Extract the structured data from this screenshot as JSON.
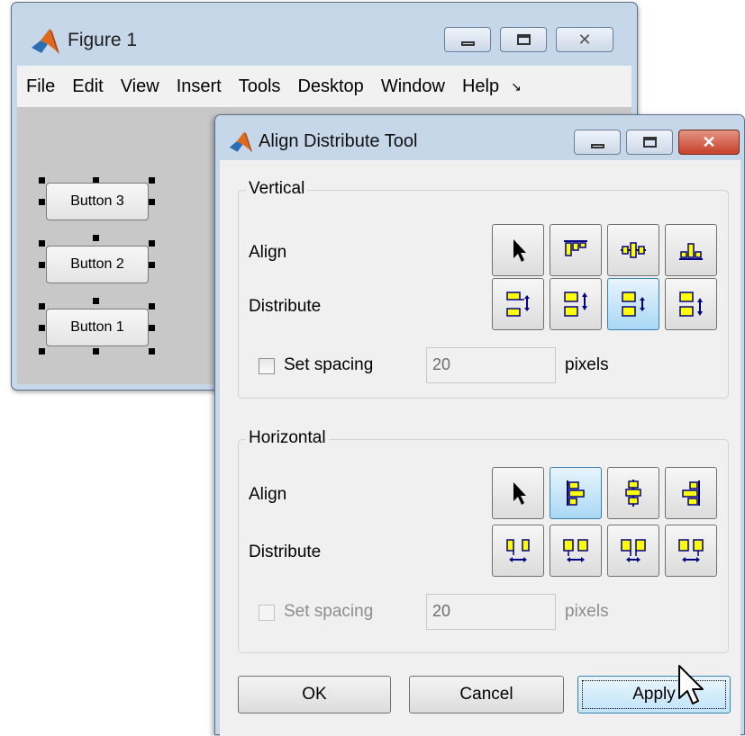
{
  "figure": {
    "title": "Figure 1",
    "menu": [
      "File",
      "Edit",
      "View",
      "Insert",
      "Tools",
      "Desktop",
      "Window",
      "Help"
    ],
    "menu_more": "↘",
    "buttons": [
      "Button 3",
      "Button 2",
      "Button 1"
    ]
  },
  "tool": {
    "title": "Align Distribute Tool",
    "vertical": {
      "title": "Vertical",
      "align_label": "Align",
      "distribute_label": "Distribute",
      "align_icons": [
        "pointer-icon",
        "align-top-icon",
        "align-middle-icon",
        "align-bottom-icon"
      ],
      "distribute_icons": [
        "distribute-top-icon",
        "distribute-middle-icon",
        "distribute-gap-icon",
        "distribute-bottom-icon"
      ],
      "selected_distribute": 2,
      "spacing_label": "Set spacing",
      "spacing_value": "20",
      "spacing_unit": "pixels",
      "spacing_checked": false
    },
    "horizontal": {
      "title": "Horizontal",
      "align_label": "Align",
      "distribute_label": "Distribute",
      "align_icons": [
        "pointer-icon",
        "align-left-icon",
        "align-center-icon",
        "align-right-icon"
      ],
      "distribute_icons": [
        "distribute-left-icon",
        "distribute-center-icon",
        "distribute-gap-icon",
        "distribute-right-icon"
      ],
      "selected_align": 1,
      "spacing_label": "Set spacing",
      "spacing_value": "20",
      "spacing_unit": "pixels",
      "spacing_enabled": false
    },
    "ok_label": "OK",
    "cancel_label": "Cancel",
    "apply_label": "Apply"
  },
  "colors": {
    "icon_fill": "#ffff00",
    "icon_stroke": "#000080",
    "selected_bg": "#a9d8f5",
    "close_button": "#c6402a"
  }
}
